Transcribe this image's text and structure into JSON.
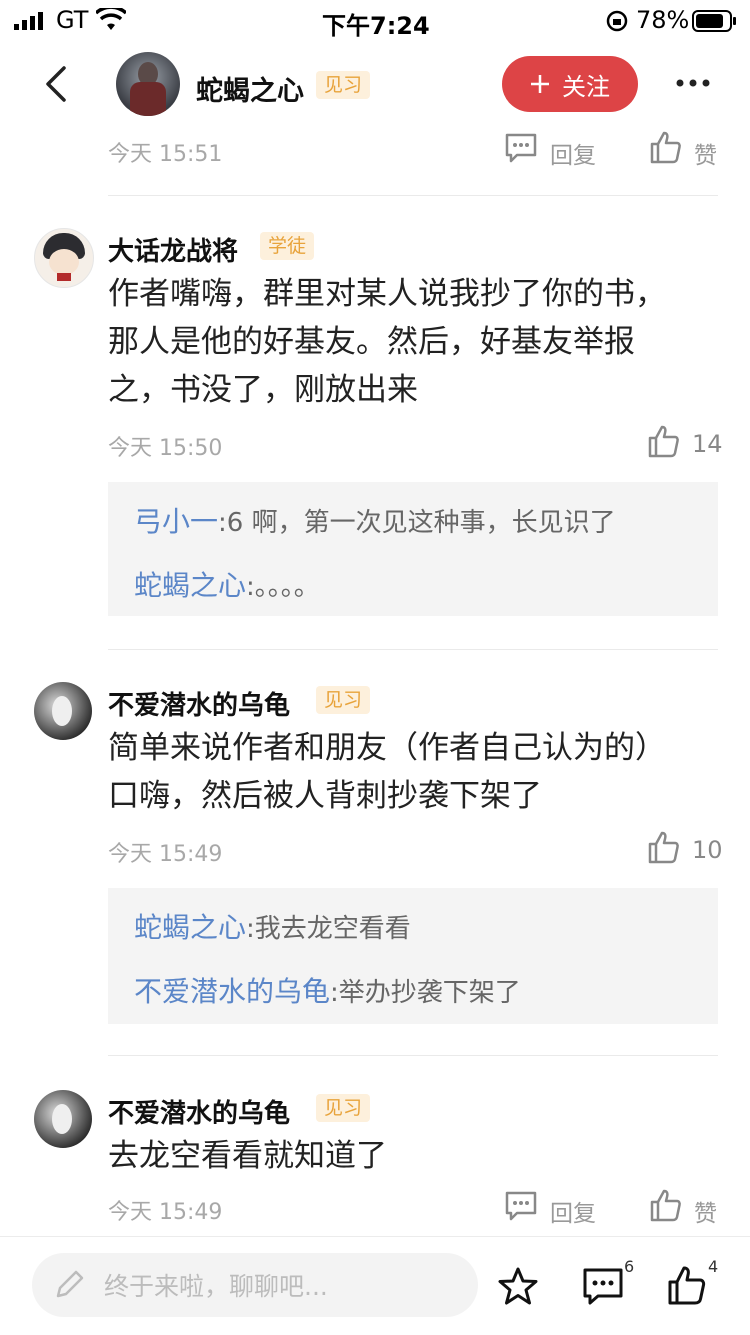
{
  "status_bar": {
    "carrier": "GT",
    "time": "下午7:24",
    "battery_pct": "78%"
  },
  "header": {
    "back_icon": "chevron-left-icon",
    "author_name": "蛇蝎之心",
    "author_badge": "见习",
    "follow_label": "关注",
    "more_icon": "more-dots-icon"
  },
  "top_comment": {
    "time": "今天 15:51",
    "reply_label": "回复",
    "like_label": "赞"
  },
  "comments": [
    {
      "user": "大话龙战将",
      "badge": "学徒",
      "text_lines": [
        "作者嘴嗨，群里对某人说我抄了你的书，",
        "那人是他的好基友。然后，好基友举报",
        "之，书没了，刚放出来"
      ],
      "time": "今天 15:50",
      "likes": "14",
      "replies": [
        {
          "user": "弓小一",
          "text": ":6 啊，第一次见这种事，长见识了"
        },
        {
          "user": "蛇蝎之心",
          "text": ":。。。。"
        }
      ]
    },
    {
      "user": "不爱潜水的乌龟",
      "badge": "见习",
      "text_lines": [
        "简单来说作者和朋友（作者自己认为的）",
        "口嗨，然后被人背刺抄袭下架了"
      ],
      "time": "今天 15:49",
      "likes": "10",
      "replies": [
        {
          "user": "蛇蝎之心",
          "text": ":我去龙空看看"
        },
        {
          "user": "不爱潜水的乌龟",
          "text": ":举办抄袭下架了"
        }
      ]
    },
    {
      "user": "不爱潜水的乌龟",
      "badge": "见习",
      "text_lines": [
        "去龙空看看就知道了"
      ],
      "time": "今天 15:49",
      "reply_label": "回复",
      "like_label": "赞"
    }
  ],
  "bottom_bar": {
    "input_placeholder": "终于来啦，聊聊吧...",
    "comment_count": "6",
    "like_count": "4"
  },
  "colors": {
    "accent_red": "#dd4446",
    "reply_blue": "#5b86c8",
    "badge_orange": "#e8a33b"
  }
}
